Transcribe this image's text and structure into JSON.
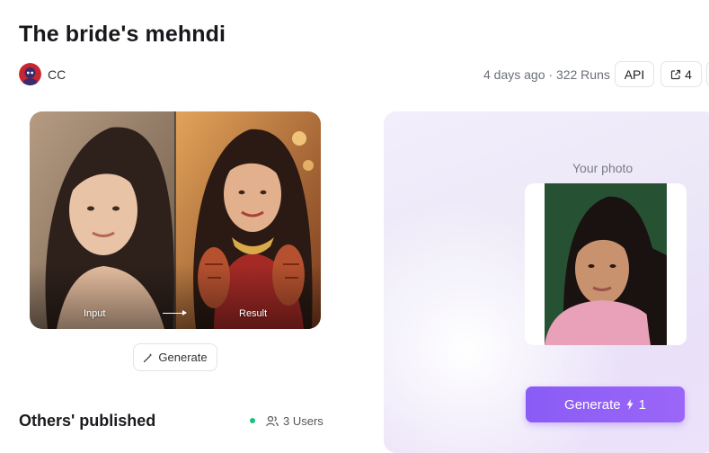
{
  "header": {
    "title": "The bride's mehndi",
    "author": "CC",
    "meta": "4 days ago · 322 Runs",
    "api_label": "API",
    "share_count": "4"
  },
  "preview": {
    "input_caption": "Input",
    "result_caption": "Result",
    "generate_label": "Generate"
  },
  "others": {
    "heading": "Others' published",
    "users": "3 Users"
  },
  "panel": {
    "your_photo_label": "Your photo",
    "generate_label": "Generate",
    "generate_cost": "1"
  },
  "colors": {
    "accent": "#8b5cf6",
    "status": "#1fbf7c",
    "panel_bg": "#ece8f7"
  },
  "icons": [
    "avatar",
    "share-icon",
    "magic-wand-icon",
    "users-icon",
    "lightning-icon",
    "arrow-right-icon"
  ]
}
